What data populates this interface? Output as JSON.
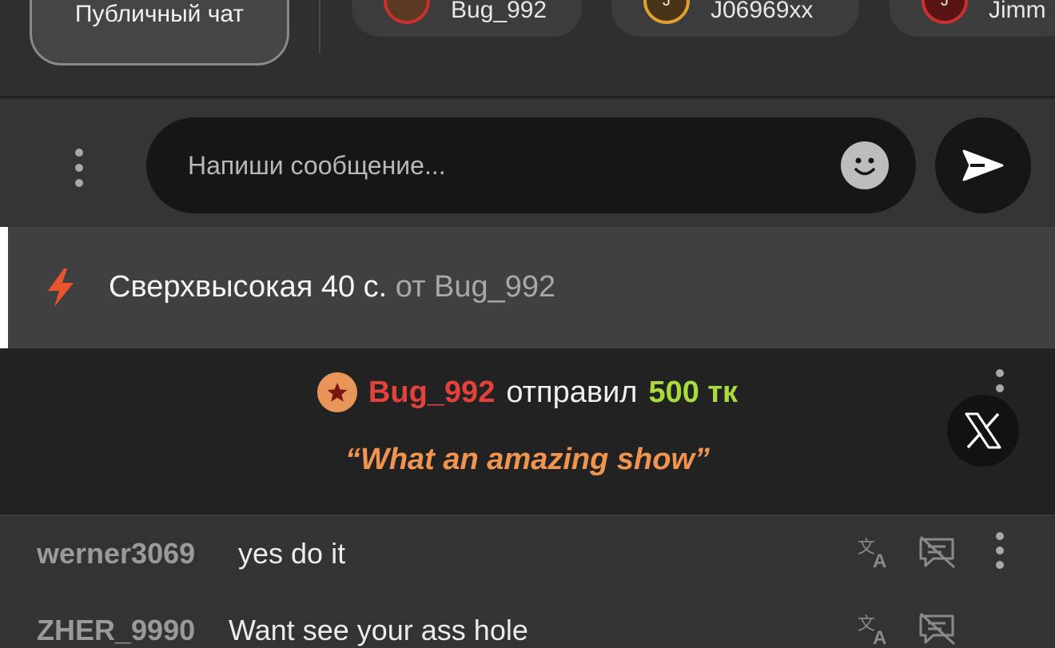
{
  "tabs": {
    "public_chat": "Публичный чат",
    "users": [
      {
        "name": "Bug_992",
        "initial": ""
      },
      {
        "name": "J06969xx",
        "initial": "J"
      },
      {
        "name": "Jimm",
        "initial": "J"
      }
    ]
  },
  "composer": {
    "placeholder": "Напиши сообщение...",
    "icons": {
      "more": "more-vertical-icon",
      "emoji": "smiley-icon",
      "send": "send-icon"
    }
  },
  "tip_mode": {
    "icon": "lightning-icon",
    "label": "Сверхвысокая 40 с.",
    "from": "от Bug_992"
  },
  "tip_notification": {
    "badge_icon": "star-icon",
    "username": "Bug_992",
    "verb": "отправил",
    "amount": "500 тк",
    "message": "“What an amazing show”",
    "close_icon": "x-logo-icon"
  },
  "messages": [
    {
      "username": "werner3069",
      "text": "yes do it"
    },
    {
      "username": "ZHER_9990",
      "text": "Want see your ass hole"
    }
  ],
  "colors": {
    "tip_username": "#e2423a",
    "tip_amount": "#a8dc3c",
    "tip_message": "#f0944f",
    "bolt": "#e8542e"
  }
}
